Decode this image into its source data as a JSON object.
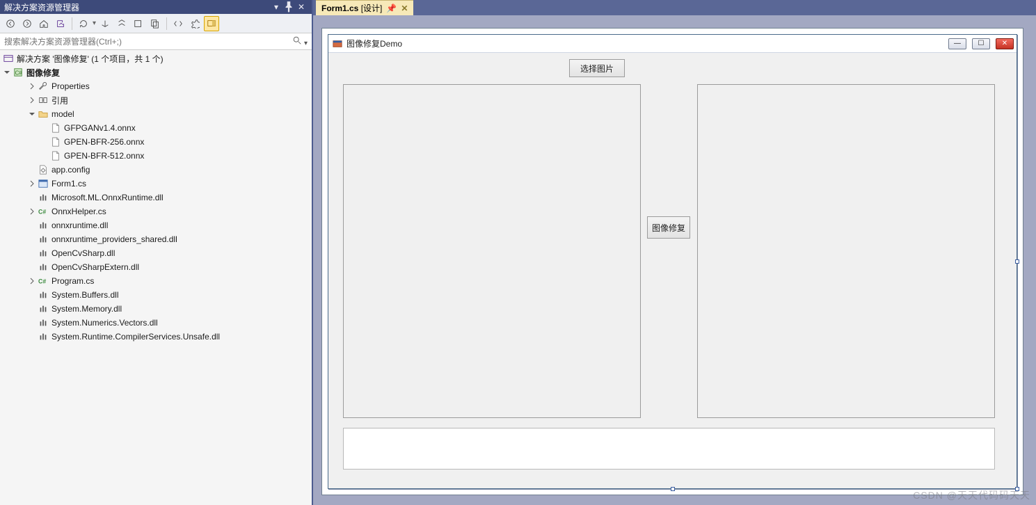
{
  "sidebar": {
    "title": "解决方案资源管理器",
    "search_placeholder": "搜索解决方案资源管理器(Ctrl+;)",
    "titlebar_buttons": [
      "window-position-icon",
      "pin-icon",
      "close-icon"
    ]
  },
  "tree": {
    "solution": "解决方案 '图像修复' (1 个项目，共 1 个)",
    "project": "图像修复",
    "items": [
      {
        "depth": 2,
        "expand": "closed",
        "icon": "wrench-icon",
        "label": "Properties"
      },
      {
        "depth": 2,
        "expand": "closed",
        "icon": "refs-icon",
        "label": "引用"
      },
      {
        "depth": 2,
        "expand": "open",
        "icon": "folder-icon",
        "label": "model"
      },
      {
        "depth": 3,
        "expand": "none",
        "icon": "file-icon",
        "label": "GFPGANv1.4.onnx"
      },
      {
        "depth": 3,
        "expand": "none",
        "icon": "file-icon",
        "label": "GPEN-BFR-256.onnx"
      },
      {
        "depth": 3,
        "expand": "none",
        "icon": "file-icon",
        "label": "GPEN-BFR-512.onnx"
      },
      {
        "depth": 2,
        "expand": "none",
        "icon": "config-icon",
        "label": "app.config"
      },
      {
        "depth": 2,
        "expand": "closed",
        "icon": "form-icon",
        "label": "Form1.cs"
      },
      {
        "depth": 2,
        "expand": "none",
        "icon": "dll-icon",
        "label": "Microsoft.ML.OnnxRuntime.dll"
      },
      {
        "depth": 2,
        "expand": "closed",
        "icon": "cs-icon",
        "label": "OnnxHelper.cs"
      },
      {
        "depth": 2,
        "expand": "none",
        "icon": "dll-icon",
        "label": "onnxruntime.dll"
      },
      {
        "depth": 2,
        "expand": "none",
        "icon": "dll-icon",
        "label": "onnxruntime_providers_shared.dll"
      },
      {
        "depth": 2,
        "expand": "none",
        "icon": "dll-icon",
        "label": "OpenCvSharp.dll"
      },
      {
        "depth": 2,
        "expand": "none",
        "icon": "dll-icon",
        "label": "OpenCvSharpExtern.dll"
      },
      {
        "depth": 2,
        "expand": "closed",
        "icon": "cs-icon",
        "label": "Program.cs"
      },
      {
        "depth": 2,
        "expand": "none",
        "icon": "dll-icon",
        "label": "System.Buffers.dll"
      },
      {
        "depth": 2,
        "expand": "none",
        "icon": "dll-icon",
        "label": "System.Memory.dll"
      },
      {
        "depth": 2,
        "expand": "none",
        "icon": "dll-icon",
        "label": "System.Numerics.Vectors.dll"
      },
      {
        "depth": 2,
        "expand": "none",
        "icon": "dll-icon",
        "label": "System.Runtime.CompilerServices.Unsafe.dll"
      }
    ]
  },
  "tab": {
    "file": "Form1.cs",
    "mode": "[设计]"
  },
  "winform": {
    "title": "图像修复Demo",
    "select_button": "选择图片",
    "repair_button": "图像修复"
  },
  "watermark": "CSDN @天天代码码天天"
}
